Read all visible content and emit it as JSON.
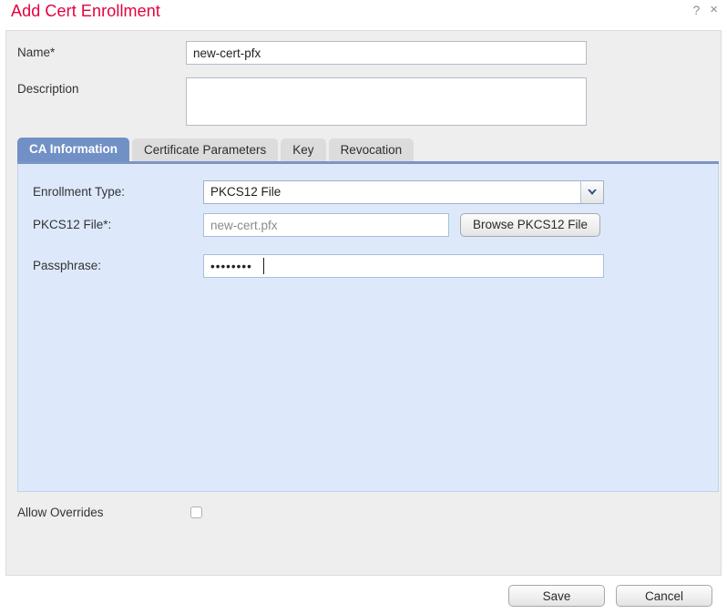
{
  "dialog": {
    "title": "Add Cert Enrollment",
    "help_icon": "?",
    "close_icon": "×"
  },
  "form": {
    "name": {
      "label": "Name*",
      "value": "new-cert-pfx"
    },
    "description": {
      "label": "Description",
      "value": ""
    }
  },
  "tabs": [
    {
      "label": "CA Information",
      "active": true
    },
    {
      "label": "Certificate Parameters",
      "active": false
    },
    {
      "label": "Key",
      "active": false
    },
    {
      "label": "Revocation",
      "active": false
    }
  ],
  "ca_information": {
    "enrollment_type": {
      "label": "Enrollment Type:",
      "value": "PKCS12 File"
    },
    "pkcs12_file": {
      "label": "PKCS12 File*:",
      "placeholder": "new-cert.pfx",
      "value": "",
      "browse_button": "Browse PKCS12 File"
    },
    "passphrase": {
      "label": "Passphrase:",
      "value": "••••••••"
    }
  },
  "allow_overrides": {
    "label": "Allow Overrides",
    "checked": false
  },
  "footer": {
    "save_label": "Save",
    "cancel_label": "Cancel"
  },
  "colors": {
    "title": "#e4003e",
    "active_tab": "#7190c6",
    "panel_bg": "#dde9fb",
    "form_bg": "#eeeeee",
    "rule": "#7b96c4"
  }
}
